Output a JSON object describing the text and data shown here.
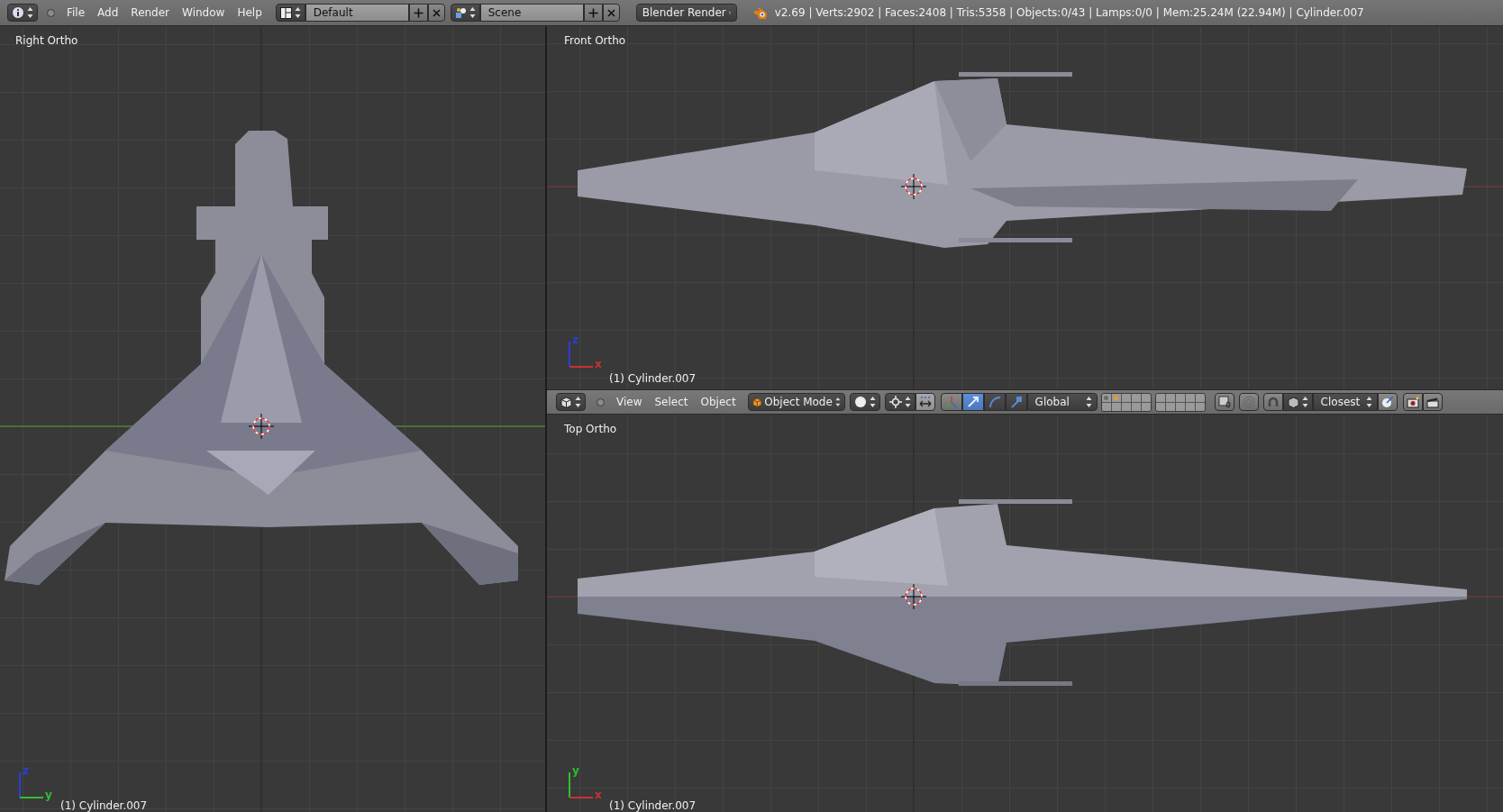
{
  "top_bar": {
    "menus": [
      "File",
      "Add",
      "Render",
      "Window",
      "Help"
    ],
    "screen_layout": "Default",
    "scene": "Scene",
    "render_engine": "Blender Render",
    "stats": "v2.69 | Verts:2902 | Faces:2408 | Tris:5358 | Objects:0/43 | Lamps:0/0 | Mem:25.24M (22.94M) | Cylinder.007"
  },
  "viewports": [
    {
      "title": "Right Ortho",
      "kind": "right",
      "object": "(1) Cylinder.007",
      "axes": [
        {
          "label": "z",
          "color": "#2a3fd8"
        },
        {
          "label": "y",
          "color": "#2fbf2f"
        }
      ]
    },
    {
      "title": "Front Ortho",
      "kind": "front",
      "object": "(1) Cylinder.007",
      "axes": [
        {
          "label": "z",
          "color": "#2a3fd8"
        },
        {
          "label": "x",
          "color": "#c83232"
        }
      ]
    },
    {
      "title": "Top Ortho",
      "kind": "top",
      "object": "(1) Cylinder.007",
      "axes": [
        {
          "label": "y",
          "color": "#2fbf2f"
        },
        {
          "label": "x",
          "color": "#c83232"
        }
      ]
    }
  ],
  "view_header": {
    "menus": [
      "View",
      "Select",
      "Object"
    ],
    "mode": "Object Mode",
    "manipulators": [
      {
        "kind": "translate",
        "selected": true
      },
      {
        "kind": "rotate",
        "selected": false
      },
      {
        "kind": "scale",
        "selected": false
      }
    ],
    "orientation": "Global",
    "layers": [
      {
        "kind": "objects"
      },
      {
        "kind": "active"
      },
      {
        "kind": "empty"
      },
      {
        "kind": "empty"
      },
      {
        "kind": "empty"
      },
      {
        "kind": "empty"
      },
      {
        "kind": "empty"
      },
      {
        "kind": "empty"
      },
      {
        "kind": "empty"
      },
      {
        "kind": "empty"
      },
      {
        "kind": "empty"
      },
      {
        "kind": "empty"
      },
      {
        "kind": "empty"
      },
      {
        "kind": "empty"
      },
      {
        "kind": "empty"
      },
      {
        "kind": "empty"
      },
      {
        "kind": "empty"
      },
      {
        "kind": "empty"
      },
      {
        "kind": "empty"
      },
      {
        "kind": "empty"
      }
    ],
    "snap_target": "Closest"
  }
}
